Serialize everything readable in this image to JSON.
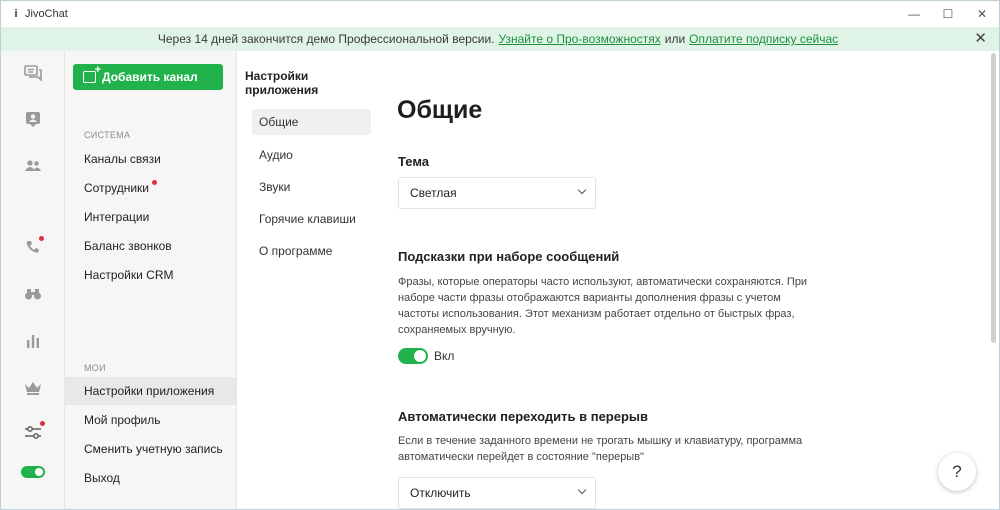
{
  "window": {
    "app_icon": "i",
    "title": "JivoChat",
    "minimize": "—",
    "maximize": "☐",
    "close": "✕"
  },
  "banner": {
    "text_before": "Через 14 дней закончится демо Профессиональной версии.",
    "link1": "Узнайте о Про-возможностях",
    "text_middle": "или",
    "link2": "Оплатите подписку сейчас",
    "close": "✕"
  },
  "rail": {
    "icons": [
      "chat-icon",
      "visitor-icon",
      "team-icon",
      "phone-icon",
      "binoculars-icon",
      "stats-icon",
      "crown-icon",
      "settings-sliders-icon",
      "online-toggle"
    ]
  },
  "nav": {
    "add_channel": "Добавить канал",
    "system_label": "СИСТЕМА",
    "system_items": [
      "Каналы связи",
      "Сотрудники",
      "Интеграции",
      "Баланс звонков",
      "Настройки CRM"
    ],
    "mine_label": "МОИ",
    "mine_items": [
      "Настройки приложения",
      "Мой профиль",
      "Сменить учетную запись",
      "Выход"
    ]
  },
  "settings_menu": {
    "title": "Настройки приложения",
    "items": [
      "Общие",
      "Аудио",
      "Звуки",
      "Горячие клавиши",
      "О программе"
    ]
  },
  "main": {
    "heading": "Общие",
    "theme_label": "Тема",
    "theme_value": "Светлая",
    "hints_label": "Подсказки при наборе сообщений",
    "hints_desc": "Фразы, которые операторы часто используют, автоматически сохраняются. При наборе части фразы отображаются варианты дополнения фразы с учетом частоты использования. Этот механизм работает отдельно от быстрых фраз, сохраняемых вручную.",
    "hints_toggle": "Вкл",
    "break_label": "Автоматически переходить в перерыв",
    "break_desc": "Если в течение заданного времени не трогать мышку и клавиатуру, программа автоматически перейдет в состояние \"перерыв\"",
    "break_value": "Отключить"
  },
  "help": "?",
  "colors": {
    "accent": "#21b24b",
    "banner_bg": "#dff3e6",
    "link": "#1f8f3e",
    "badge": "#e0313b"
  }
}
